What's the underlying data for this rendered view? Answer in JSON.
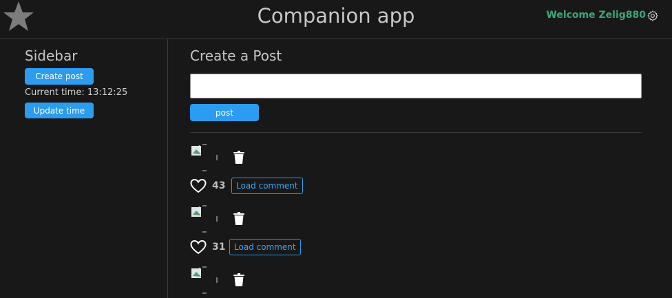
{
  "header": {
    "title": "Companion app",
    "welcome": "Welcome Zelig880",
    "logo_icon": "star-icon",
    "settings_icon": "gear-icon"
  },
  "sidebar": {
    "title": "Sidebar",
    "create_post_label": "Create post",
    "current_time_label": "Current time: 13:12:25",
    "update_time_label": "Update time"
  },
  "main": {
    "title": "Create a Post",
    "post_input_value": "",
    "post_button_label": "post"
  },
  "posts": [
    {
      "likes": "43",
      "load_comment_label": "Load comment"
    },
    {
      "likes": "31",
      "load_comment_label": "Load comment"
    },
    {
      "likes": "",
      "load_comment_label": ""
    }
  ],
  "colors": {
    "accent": "#2b9cf0",
    "welcome": "#3ba776",
    "background": "#181818"
  }
}
